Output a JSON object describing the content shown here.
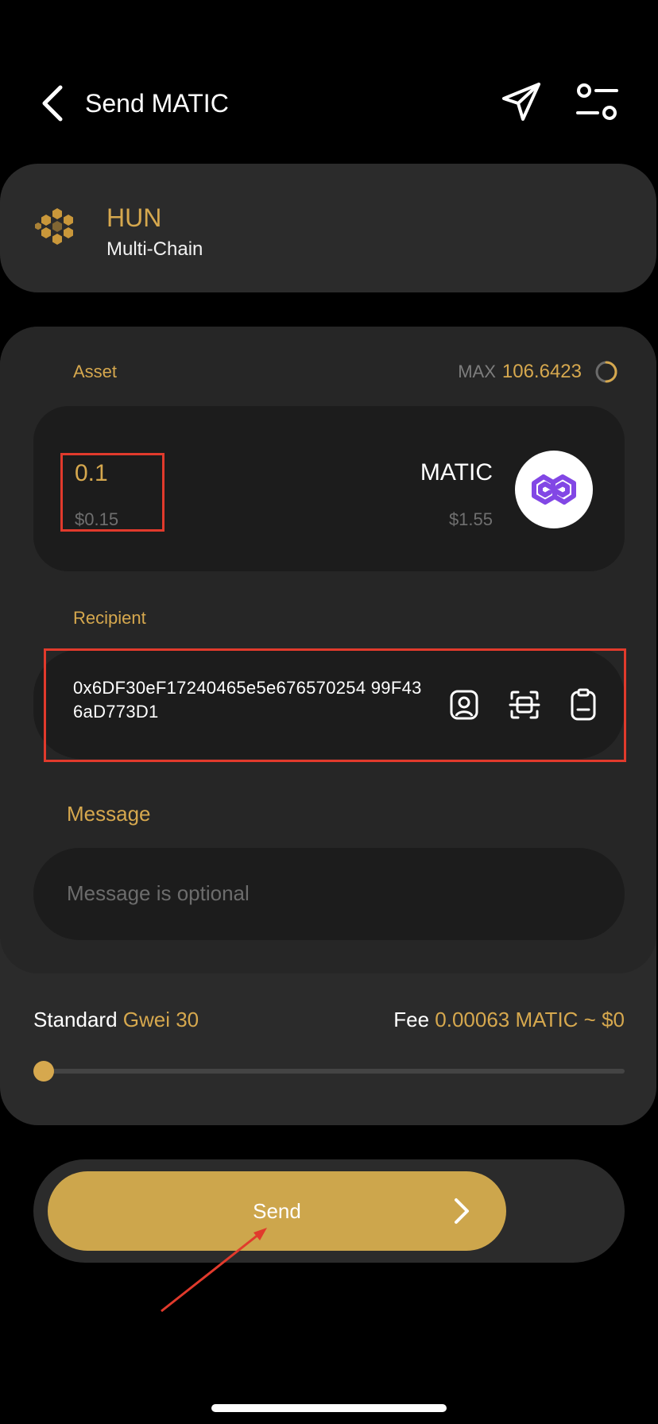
{
  "header": {
    "title": "Send MATIC"
  },
  "wallet": {
    "name": "HUN",
    "subtitle": "Multi-Chain"
  },
  "asset": {
    "label": "Asset",
    "max_label": "MAX",
    "max_value": "106.6423",
    "amount": "0.1",
    "amount_usd": "$0.15",
    "token_symbol": "MATIC",
    "token_price": "$1.55"
  },
  "recipient": {
    "label": "Recipient",
    "address": "0x6DF30eF17240465e5e676570254 99F436aD773D1"
  },
  "message": {
    "label": "Message",
    "placeholder": "Message is optional"
  },
  "fee": {
    "speed_label": "Standard",
    "gwei": "Gwei 30",
    "fee_label": "Fee",
    "fee_value": "0.00063 MATIC ~ $0",
    "slider_position": 0
  },
  "send": {
    "label": "Send"
  },
  "colors": {
    "accent": "#d6a84e",
    "send_button": "#cda64c",
    "annotation": "#e13a2c",
    "polygon": "#8247e5"
  }
}
